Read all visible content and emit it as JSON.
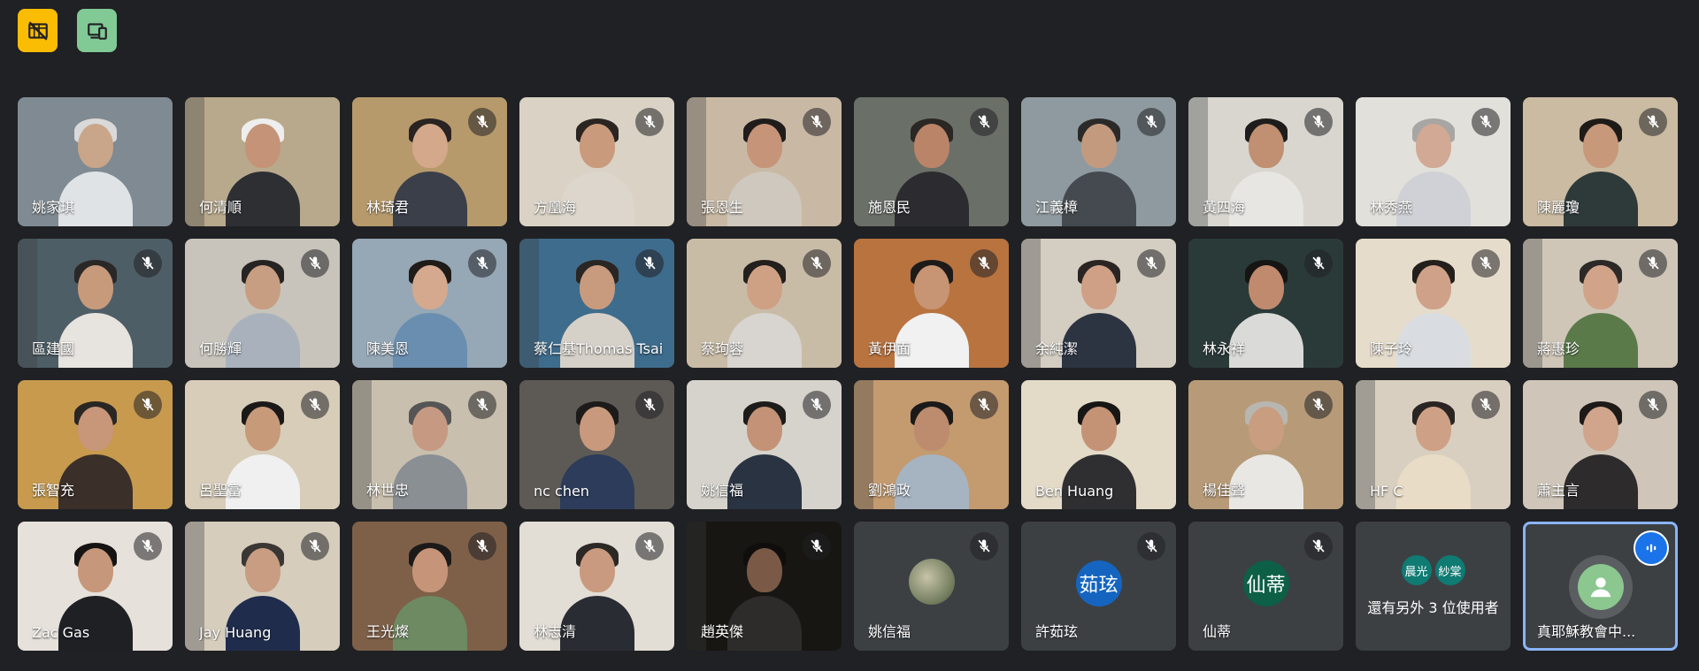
{
  "toolbar": {
    "buttons": [
      {
        "icon": "hidden-tiles-icon",
        "color": "#fbbc04"
      },
      {
        "icon": "presentation-device-icon",
        "color": "#81c995"
      }
    ]
  },
  "colors": {
    "background": "#202124",
    "tile": "#3c4043",
    "active_border": "#8ab4f8",
    "speaking": "#1a73e8"
  },
  "participants": [
    {
      "name": "姚家琪",
      "muted": false,
      "kind": "video",
      "bg": "#7f8a92",
      "skin": "#c9a58a",
      "shirt": "#dfe3e6",
      "hair": "#d9d9d9"
    },
    {
      "name": "何清順",
      "muted": false,
      "kind": "video",
      "bg": "#b9a98c",
      "skin": "#c59377",
      "shirt": "#2d2f33",
      "hair": "#eeeeee"
    },
    {
      "name": "林琦君",
      "muted": true,
      "kind": "video",
      "bg": "#b79a6b",
      "skin": "#d4a88a",
      "shirt": "#3a3f4a",
      "hair": "#2a2321"
    },
    {
      "name": "方凰海",
      "muted": true,
      "kind": "video",
      "bg": "#d9d2c5",
      "skin": "#c99a7c",
      "shirt": "#dcd6cc",
      "hair": "#2b2522"
    },
    {
      "name": "張恩生",
      "muted": true,
      "kind": "video",
      "bg": "#c9b9a4",
      "skin": "#c69479",
      "shirt": "#cfc8be",
      "hair": "#1f1c1b"
    },
    {
      "name": "施恩民",
      "muted": true,
      "kind": "video",
      "bg": "#6a6f68",
      "skin": "#b98468",
      "shirt": "#2c2b2f",
      "hair": "#2a2725"
    },
    {
      "name": "江義樟",
      "muted": true,
      "kind": "video",
      "bg": "#8f9aa0",
      "skin": "#c49a7e",
      "shirt": "#444a4f",
      "hair": "#2b2a29"
    },
    {
      "name": "黃四海",
      "muted": true,
      "kind": "video",
      "bg": "#d8d6cf",
      "skin": "#c18f71",
      "shirt": "#e8e6e2",
      "hair": "#1e1d1c"
    },
    {
      "name": "林秀燕",
      "muted": true,
      "kind": "video",
      "bg": "#e2e0da",
      "skin": "#d1a994",
      "shirt": "#cfd1d6",
      "hair": "#a8a6a3"
    },
    {
      "name": "陳麗瓊",
      "muted": true,
      "kind": "video",
      "bg": "#cbbba2",
      "skin": "#c8987a",
      "shirt": "#2e3a3a",
      "hair": "#1e1a18"
    },
    {
      "name": "區建國",
      "muted": true,
      "kind": "video",
      "bg": "#4e5e66",
      "skin": "#c79a7c",
      "shirt": "#e7e3de",
      "hair": "#2a2827"
    },
    {
      "name": "何勝輝",
      "muted": true,
      "kind": "video",
      "bg": "#c8c4bb",
      "skin": "#c89e82",
      "shirt": "#a9b2bc",
      "hair": "#262423"
    },
    {
      "name": "陳美恩",
      "muted": true,
      "kind": "video",
      "bg": "#96a7b6",
      "skin": "#d4a98e",
      "shirt": "#6a8eb0",
      "hair": "#1f1b19"
    },
    {
      "name": "蔡仁基Thomas Tsai",
      "muted": true,
      "kind": "video",
      "bg": "#3e6c8c",
      "skin": "#c89b7e",
      "shirt": "#d6d1c8",
      "hair": "#2a2623"
    },
    {
      "name": "蔡珣蓉",
      "muted": true,
      "kind": "video",
      "bg": "#c9bca7",
      "skin": "#cfa184",
      "shirt": "#d8d4d0",
      "hair": "#221f1d"
    },
    {
      "name": "黃伊面",
      "muted": true,
      "kind": "video",
      "bg": "#b8733f",
      "skin": "#c79474",
      "shirt": "#f1f1f1",
      "hair": "#1d1b1a"
    },
    {
      "name": "余純潔",
      "muted": true,
      "kind": "video",
      "bg": "#d4cdc1",
      "skin": "#cfa085",
      "shirt": "#2c3442",
      "hair": "#2a2523"
    },
    {
      "name": "林永祥",
      "muted": true,
      "kind": "video",
      "bg": "#2a3a38",
      "skin": "#c08a6e",
      "shirt": "#dadbd8",
      "hair": "#161514"
    },
    {
      "name": "陳子玲",
      "muted": true,
      "kind": "video",
      "bg": "#e6dccb",
      "skin": "#cfa188",
      "shirt": "#d9dde2",
      "hair": "#231f1c"
    },
    {
      "name": "蔣惠珍",
      "muted": true,
      "kind": "video",
      "bg": "#cfc6b8",
      "skin": "#d1a48a",
      "shirt": "#5b7a4a",
      "hair": "#2d2926"
    },
    {
      "name": "張智充",
      "muted": true,
      "kind": "video",
      "bg": "#c79a4e",
      "skin": "#c89678",
      "shirt": "#3a2f29",
      "hair": "#2a2624"
    },
    {
      "name": "呂聖富",
      "muted": true,
      "kind": "video",
      "bg": "#d8cdb9",
      "skin": "#c79a7a",
      "shirt": "#f0f0f0",
      "hair": "#1b1918"
    },
    {
      "name": "林世忠",
      "muted": true,
      "kind": "video",
      "bg": "#c8bfae",
      "skin": "#c69a82",
      "shirt": "#8a8f94",
      "hair": "#555"
    },
    {
      "name": "nc chen",
      "muted": true,
      "kind": "video",
      "bg": "#5d5a56",
      "skin": "#c8997c",
      "shirt": "#2c3c5a",
      "hair": "#1c1b1a"
    },
    {
      "name": "姚信福",
      "muted": true,
      "kind": "video",
      "bg": "#d6d3cc",
      "skin": "#c49276",
      "shirt": "#2a3342",
      "hair": "#1e1c1b"
    },
    {
      "name": "劉鴻政",
      "muted": true,
      "kind": "video",
      "bg": "#c49a6f",
      "skin": "#bd8b6d",
      "shirt": "#a6b4c2",
      "hair": "#1b1a19"
    },
    {
      "name": "Ben Huang",
      "muted": false,
      "kind": "video",
      "bg": "#e3dac8",
      "skin": "#c49376",
      "shirt": "#2f2f31",
      "hair": "#171615"
    },
    {
      "name": "楊佳聲",
      "muted": true,
      "kind": "video",
      "bg": "#b79b78",
      "skin": "#c89d80",
      "shirt": "#e9e7e3",
      "hair": "#b8b6b1"
    },
    {
      "name": "HF C",
      "muted": true,
      "kind": "video",
      "bg": "#d9cfc0",
      "skin": "#cea186",
      "shirt": "#e8dcc6",
      "hair": "#2a2522"
    },
    {
      "name": "蕭主言",
      "muted": true,
      "kind": "video",
      "bg": "#cfc6b9",
      "skin": "#d0a58b",
      "shirt": "#2d2b2c",
      "hair": "#1d1a18"
    },
    {
      "name": "Zac Gas",
      "muted": true,
      "kind": "video",
      "bg": "#e6e1da",
      "skin": "#c6977a",
      "shirt": "#1f2024",
      "hair": "#151413"
    },
    {
      "name": "Jay Huang",
      "muted": true,
      "kind": "video",
      "bg": "#d6cdbd",
      "skin": "#c89d82",
      "shirt": "#1f2c4c",
      "hair": "#3a3634"
    },
    {
      "name": "王光燦",
      "muted": true,
      "kind": "video",
      "bg": "#7e6049",
      "skin": "#c69579",
      "shirt": "#6e8a62",
      "hair": "#1c1a19"
    },
    {
      "name": "林志清",
      "muted": true,
      "kind": "video",
      "bg": "#e2ddd5",
      "skin": "#c99a7f",
      "shirt": "#2a2c33",
      "hair": "#2b2826"
    },
    {
      "name": "趙英傑",
      "muted": true,
      "kind": "video",
      "bg": "#171613",
      "skin": "#7a5a46",
      "shirt": "#2d2c2a",
      "hair": "#0f0e0d"
    },
    {
      "name": "姚信福",
      "muted": true,
      "kind": "avatar-img"
    },
    {
      "name": "許茹玹",
      "muted": true,
      "kind": "avatar",
      "avatar_text": "茹玹",
      "avatar_color": "#1565c0"
    },
    {
      "name": "仙蒂",
      "muted": true,
      "kind": "avatar",
      "avatar_text": "仙蒂",
      "avatar_color": "#0d5f46"
    },
    {
      "name": "還有另外 3 位使用者",
      "muted": false,
      "kind": "more",
      "avatars": [
        "晨光",
        "紗棠"
      ]
    },
    {
      "name": "真耶穌教會中...",
      "muted": false,
      "kind": "self",
      "speaking": true
    }
  ]
}
